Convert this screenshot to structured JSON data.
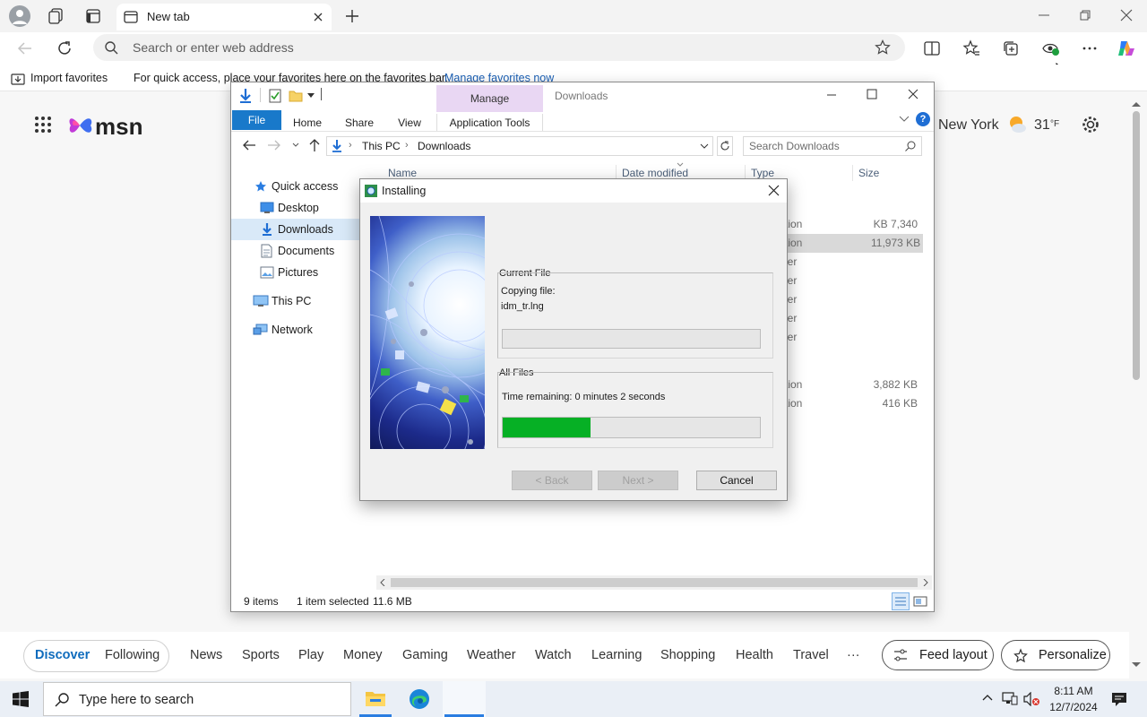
{
  "browser": {
    "tab_title": "New tab",
    "address_placeholder": "Search or enter web address",
    "import_favorites": "Import favorites",
    "favbar_message": "For quick access, place your favorites here on the favorites bar.",
    "manage_favorites": "Manage favorites now"
  },
  "msn": {
    "logo": "msn",
    "city": "New York",
    "temp": "31",
    "temp_unit": "°F",
    "nav": [
      "Discover",
      "Following",
      "News",
      "Sports",
      "Play",
      "Money",
      "Gaming",
      "Weather",
      "Watch",
      "Learning",
      "Shopping",
      "Health",
      "Travel",
      "···"
    ],
    "feed_layout": "Feed layout",
    "personalize": "Personalize"
  },
  "explorer": {
    "context_tab": "Manage",
    "title": "Downloads",
    "ribbon": {
      "file": "File",
      "home": "Home",
      "share": "Share",
      "view": "View",
      "app_tools": "Application Tools"
    },
    "breadcrumb": [
      "This PC",
      "Downloads"
    ],
    "search_placeholder": "Search Downloads",
    "sidebar": [
      "Quick access",
      "Desktop",
      "Downloads",
      "Documents",
      "Pictures",
      "This PC",
      "Network"
    ],
    "columns": {
      "name": "Name",
      "date": "Date modified",
      "type": "Type",
      "size": "Size"
    },
    "rows": [
      {
        "type": "tion",
        "size": "7,340 KB"
      },
      {
        "type": "tion",
        "size": "11,973 KB"
      },
      {
        "type": "ler",
        "size": ""
      },
      {
        "type": "ler",
        "size": ""
      },
      {
        "type": "ler",
        "size": ""
      },
      {
        "type": "ler",
        "size": ""
      },
      {
        "type": "ler",
        "size": ""
      },
      {
        "type": "tion",
        "size": "3,882 KB"
      },
      {
        "type": "tion",
        "size": "416 KB"
      }
    ],
    "status": {
      "items": "9 items",
      "selected": "1 item selected",
      "size": "11.6 MB"
    }
  },
  "installer": {
    "title": "Installing",
    "current_file_label": "Current File",
    "copying_label": "Copying file:",
    "file_name": "idm_tr.lng",
    "all_files_label": "All Files",
    "time_remaining": "Time remaining: 0 minutes 2 seconds",
    "current_progress": 0,
    "all_progress": 0.34,
    "back": "< Back",
    "next": "Next >",
    "cancel": "Cancel",
    "progress_color": "#06b025"
  },
  "taskbar": {
    "search_placeholder": "Type here to search",
    "time": "8:11 AM",
    "date": "12/7/2024"
  }
}
